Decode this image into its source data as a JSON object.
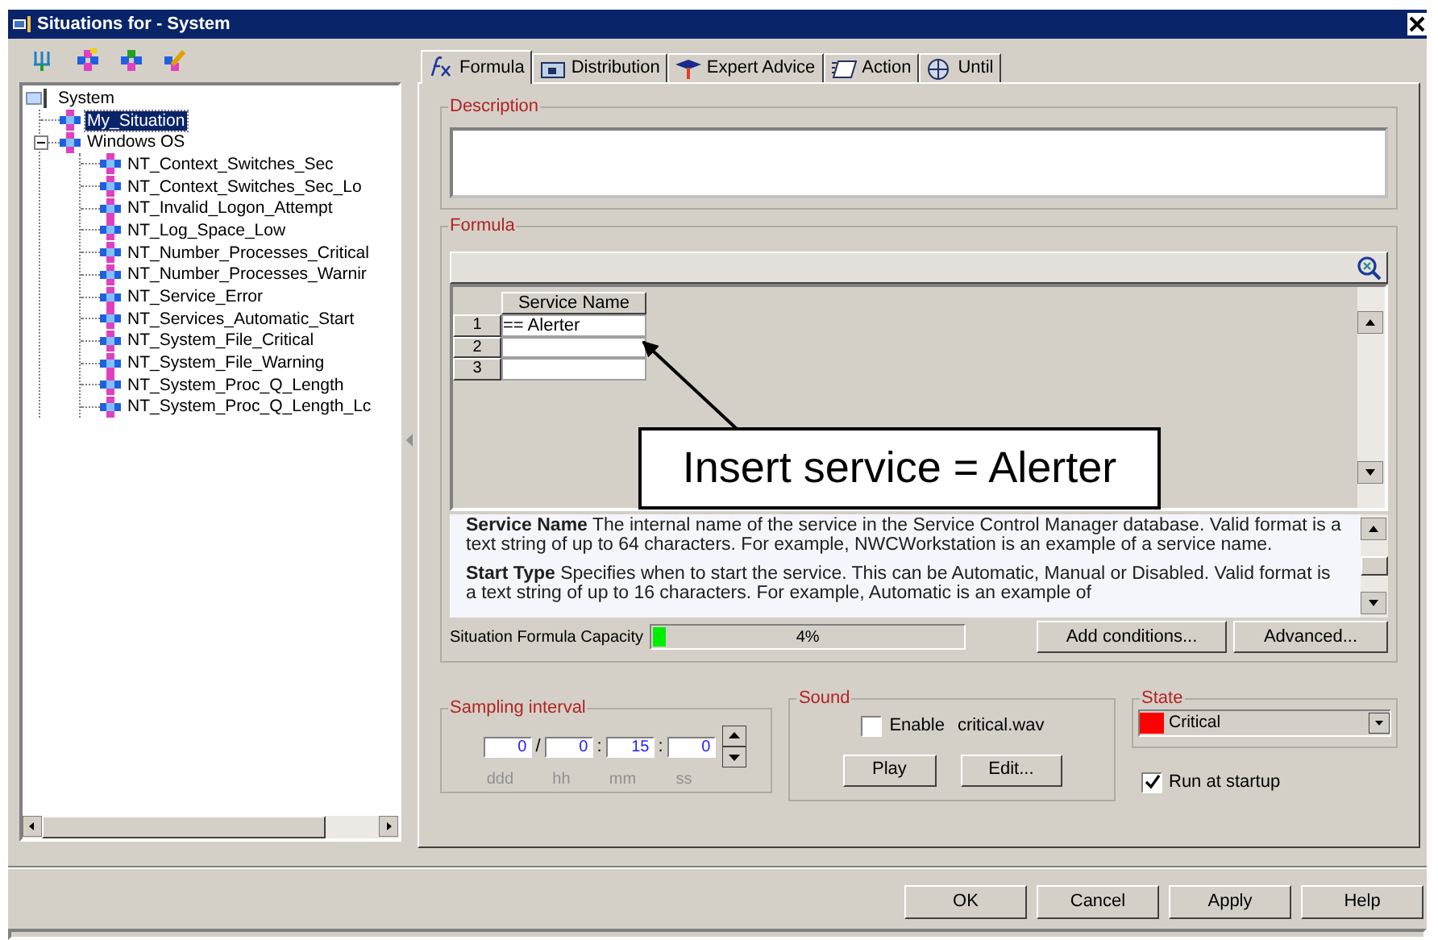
{
  "window": {
    "title": "Situations for - System"
  },
  "tree": [
    {
      "label": "System",
      "selected": false,
      "children": [
        {
          "label": "My_Situation",
          "selected": true
        },
        {
          "label": "Windows OS",
          "selected": false,
          "expanded": true,
          "children": [
            {
              "label": "NT_Context_Switches_Sec",
              "selected": false
            },
            {
              "label": "NT_Context_Switches_Sec_Lo",
              "selected": false
            },
            {
              "label": "NT_Invalid_Logon_Attempt",
              "selected": false
            },
            {
              "label": "NT_Log_Space_Low",
              "selected": false
            },
            {
              "label": "NT_Number_Processes_Critical",
              "selected": false
            },
            {
              "label": "NT_Number_Processes_Warnir",
              "selected": false
            },
            {
              "label": "NT_Service_Error",
              "selected": false
            },
            {
              "label": "NT_Services_Automatic_Start",
              "selected": false
            },
            {
              "label": "NT_System_File_Critical",
              "selected": false
            },
            {
              "label": "NT_System_File_Warning",
              "selected": false
            },
            {
              "label": "NT_System_Proc_Q_Length",
              "selected": false
            },
            {
              "label": "NT_System_Proc_Q_Length_Lc",
              "selected": false
            }
          ]
        }
      ]
    }
  ],
  "tabs": [
    {
      "label": "Formula",
      "selected": true
    },
    {
      "label": "Distribution",
      "selected": false
    },
    {
      "label": "Expert Advice",
      "selected": false
    },
    {
      "label": "Action",
      "selected": false
    },
    {
      "label": "Until",
      "selected": false
    }
  ],
  "description": {
    "legend": "Description"
  },
  "formula": {
    "legend": "Formula",
    "columns": [
      "Service Name"
    ],
    "rows": [
      {
        "number": "1",
        "cells": [
          "== Alerter"
        ]
      },
      {
        "number": "2"
      },
      {
        "number": "3"
      }
    ],
    "help": [
      "**Service Name** The internal name of the service in the Service Control Manager database. Valid format is a text string of up to 64 characters. For example, NWCWorkstation is an example of a service name.",
      "**Start Type** Specifies when to start the service. This can be Automatic, Manual or Disabled. Valid format is a text string of up to 16 characters. For example, Automatic is an example of"
    ],
    "capacity": {
      "label": "Situation Formula Capacity",
      "level": 0.04,
      "reading": "4%"
    },
    "buttons": [
      "Add conditions...",
      "Advanced..."
    ]
  },
  "annotation": {
    "text": "Insert service = Alerter"
  },
  "sampling": {
    "legend": "Sampling interval",
    "fields": [
      {
        "value": "0",
        "unit": "ddd"
      },
      {
        "separator": "/",
        "value": "0",
        "unit": "hh"
      },
      {
        "separator": ":",
        "value": "15",
        "unit": "mm"
      },
      {
        "separator": ":",
        "value": "0",
        "unit": "ss"
      }
    ]
  },
  "sound": {
    "legend": "Sound",
    "enable": {
      "label": "Enable",
      "checked": false
    },
    "file": "critical.wav",
    "buttons": [
      "Play",
      "Edit..."
    ]
  },
  "state": {
    "legend": "State",
    "value": "Critical",
    "color": "#ff0000",
    "run_at_startup": {
      "label": "Run at startup",
      "checked": true
    }
  },
  "buttons": [
    "OK",
    "Cancel",
    "Apply",
    "Help"
  ]
}
